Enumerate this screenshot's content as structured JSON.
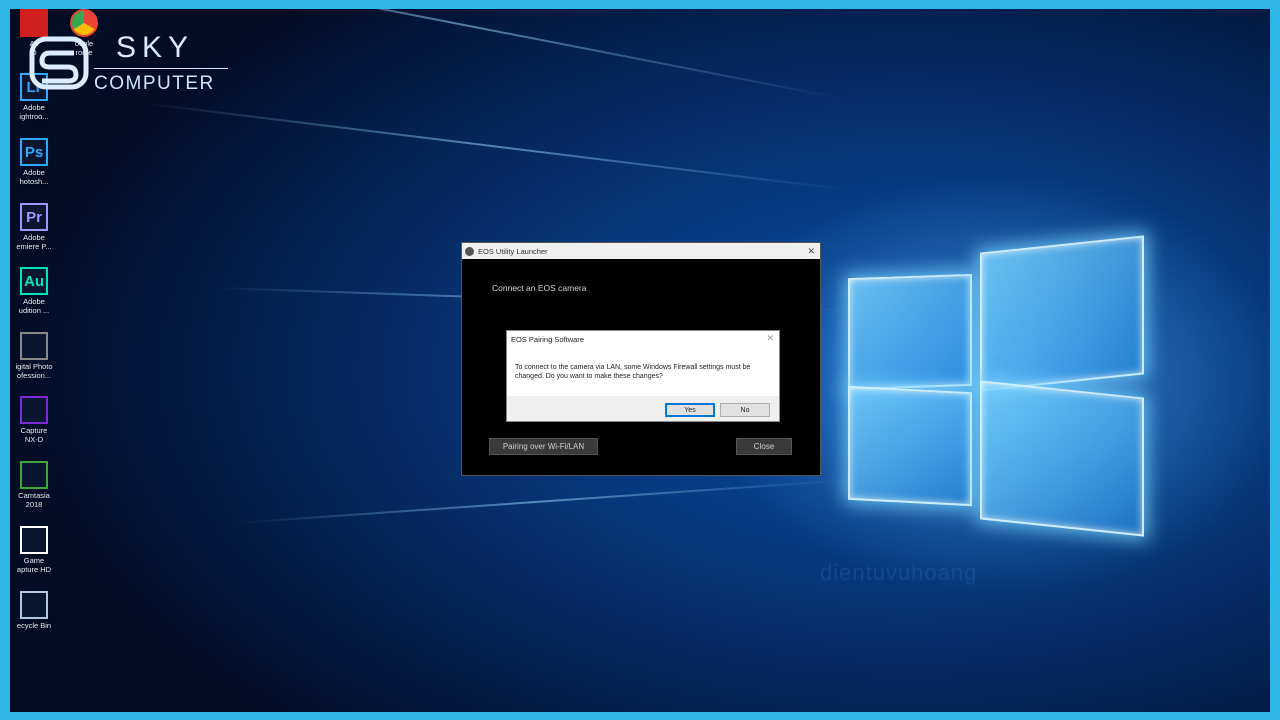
{
  "brand": {
    "name": "SKY",
    "sub": "COMPUTER"
  },
  "desktop_icons": [
    {
      "name": "adobe-acrobat-icon",
      "label": "Ac\nD",
      "glyph": "",
      "color": "#d11f1f"
    },
    {
      "name": "google-chrome-icon",
      "label": "oogle\nrome",
      "glyph": "",
      "color": "#ea4335"
    },
    {
      "name": "lightroom-icon",
      "label": "Adobe\nightroo...",
      "glyph": "Lr",
      "color": "#31a8ff"
    },
    {
      "name": "photoshop-icon",
      "label": "Adobe\nhotosh...",
      "glyph": "Ps",
      "color": "#31a8ff"
    },
    {
      "name": "premiere-icon",
      "label": "Adobe\nemiere P...",
      "glyph": "Pr",
      "color": "#9999ff"
    },
    {
      "name": "audition-icon",
      "label": "Adobe\nudition ...",
      "glyph": "Au",
      "color": "#00e4bb"
    },
    {
      "name": "digital-photo-icon",
      "label": "igital Photo\nofession...",
      "glyph": "",
      "color": "#888888"
    },
    {
      "name": "nikon-capture-icon",
      "label": "Capture\nNX-D",
      "glyph": "",
      "color": "#7a2ad6"
    },
    {
      "name": "camtasia-icon",
      "label": "Camtasia\n2018",
      "glyph": "",
      "color": "#3ca63c"
    },
    {
      "name": "game-capture-icon",
      "label": "Game\napture HD",
      "glyph": "",
      "color": "#ffffff"
    },
    {
      "name": "recycle-bin-icon",
      "label": "ecycle Bin",
      "glyph": "",
      "color": "#b0c8e0"
    }
  ],
  "launcher": {
    "title": "EOS Utility Launcher",
    "message": "Connect an EOS camera",
    "pair_button": "Pairing over Wi-Fi/LAN",
    "close_button": "Close"
  },
  "modal": {
    "title": "EOS Pairing Software",
    "body": "To connect to the camera via LAN, some Windows Firewall settings must be changed. Do you want to make these changes?",
    "yes": "Yes",
    "no": "No"
  },
  "watermark": "dientuvuhoang"
}
